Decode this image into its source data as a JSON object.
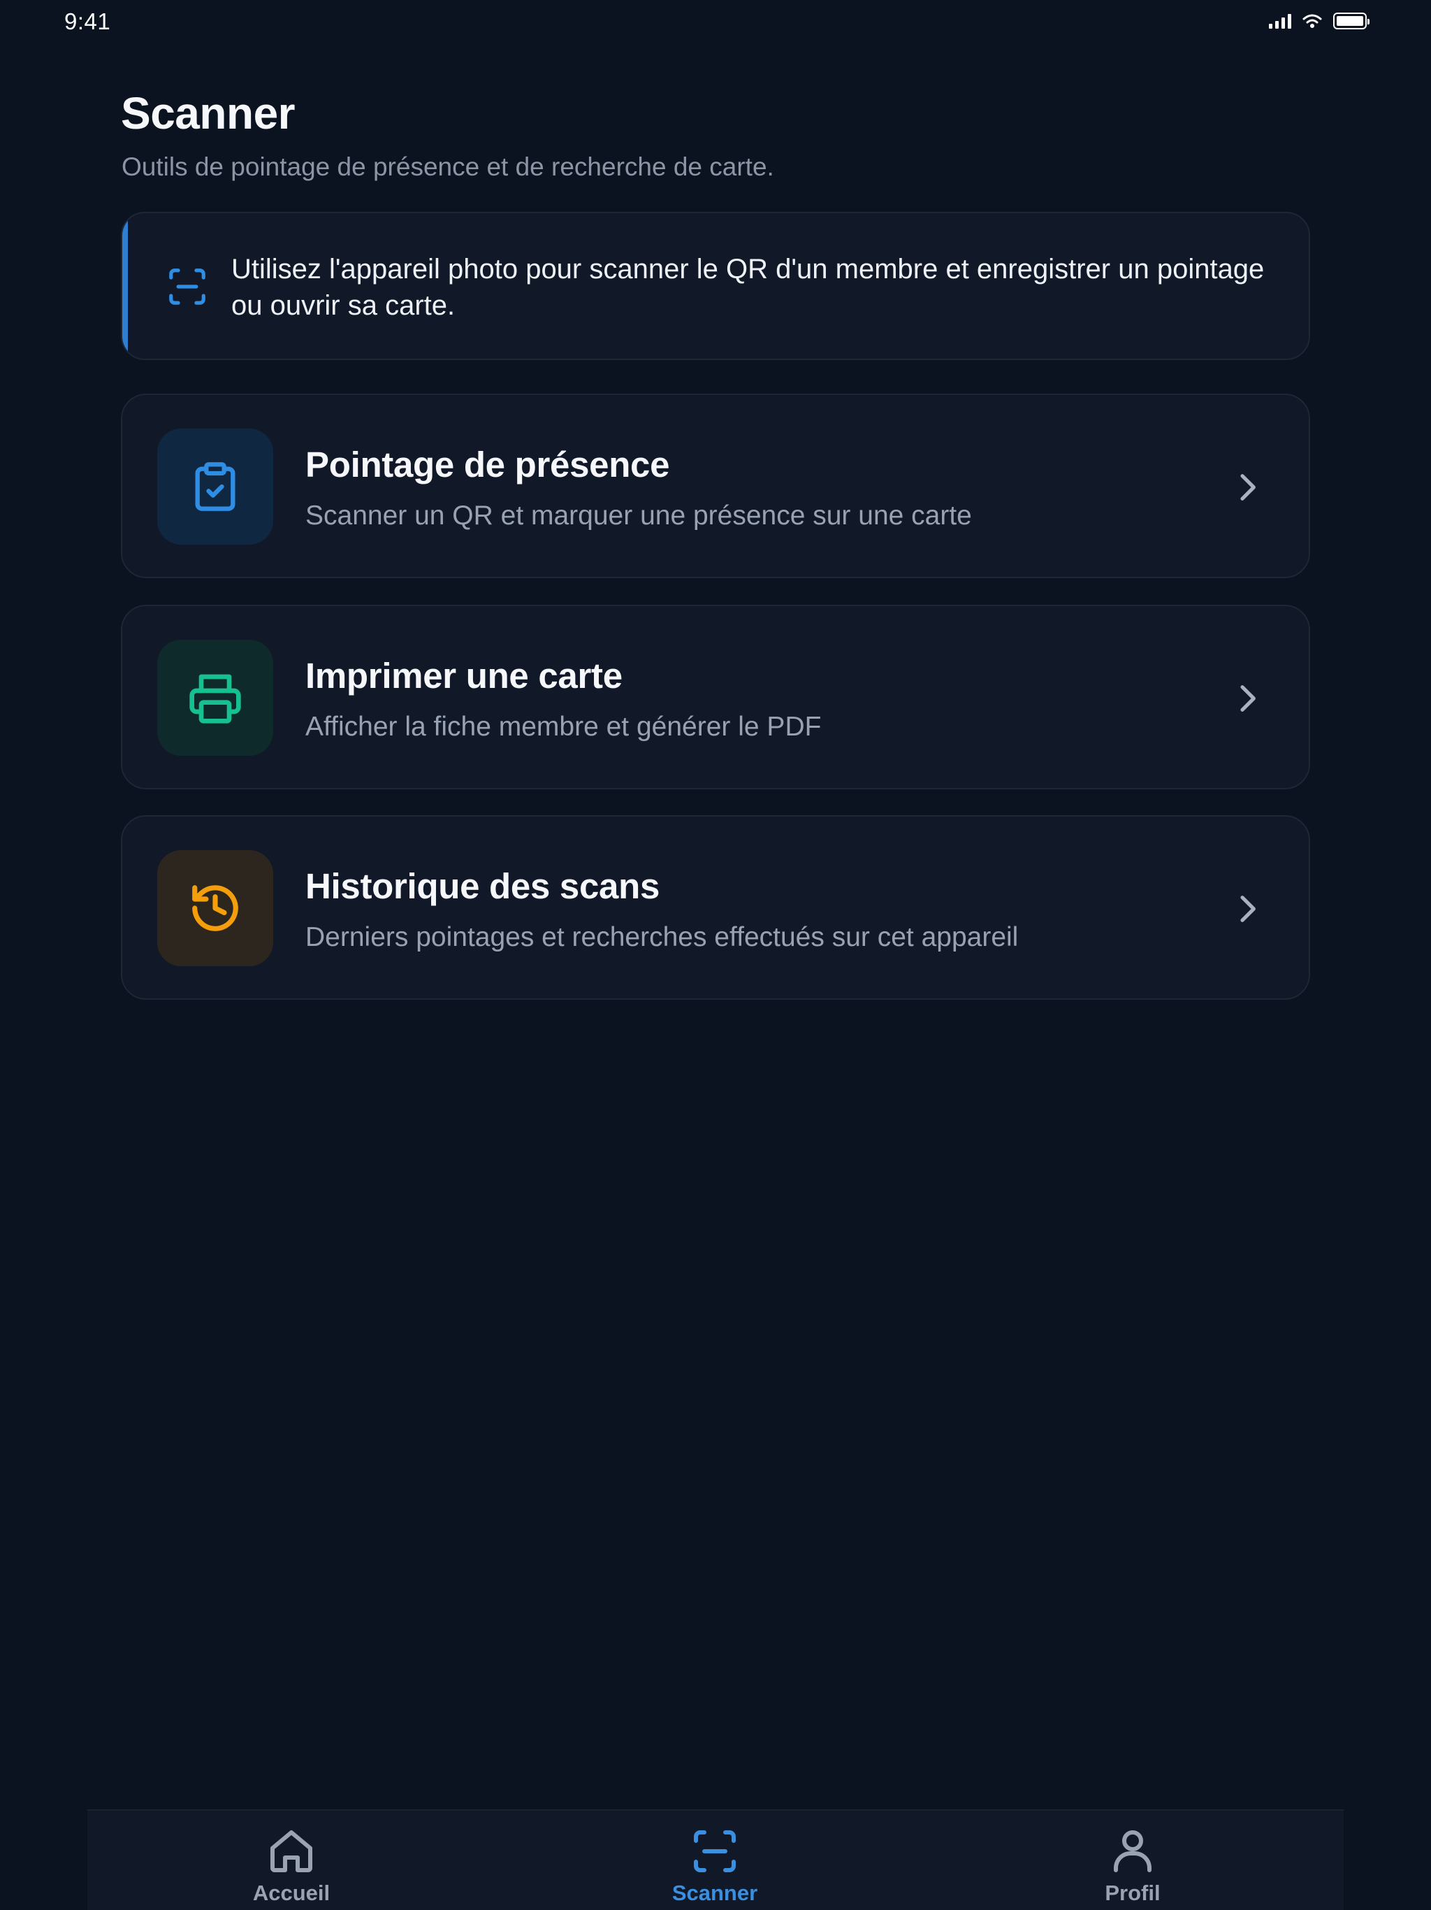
{
  "status_bar": {
    "time": "9:41",
    "icons": [
      "signal-icon",
      "wifi-icon",
      "battery-icon"
    ]
  },
  "header": {
    "title": "Scanner",
    "subtitle": "Outils de pointage de présence et de recherche de carte."
  },
  "info_card": {
    "icon": "scan-icon",
    "text": "Utilisez l'appareil photo pour scanner le QR d'un membre et enregistrer un pointage ou ouvrir sa carte.",
    "accent_color": "#2f7fd1"
  },
  "actions": [
    {
      "icon": "clipboard-check-icon",
      "title": "Pointage de présence",
      "description": "Scanner un QR et marquer une présence sur une carte",
      "icon_color": "#2f8de4",
      "icon_bg": "#0f2740"
    },
    {
      "icon": "printer-icon",
      "title": "Imprimer une carte",
      "description": "Afficher la fiche membre et générer le PDF",
      "icon_color": "#16c08f",
      "icon_bg": "#0f2a2b"
    },
    {
      "icon": "history-icon",
      "title": "Historique des scans",
      "description": "Derniers pointages et recherches effectués sur cet appareil",
      "icon_color": "#f59e0b",
      "icon_bg": "#2c261f"
    }
  ],
  "bottom_nav": {
    "items": [
      {
        "label": "Accueil",
        "icon": "home-icon",
        "active": false
      },
      {
        "label": "Scanner",
        "icon": "scan-icon",
        "active": true
      },
      {
        "label": "Profil",
        "icon": "user-icon",
        "active": false
      }
    ],
    "active_color": "#3b8fe0",
    "inactive_color": "#9aa3b2"
  }
}
